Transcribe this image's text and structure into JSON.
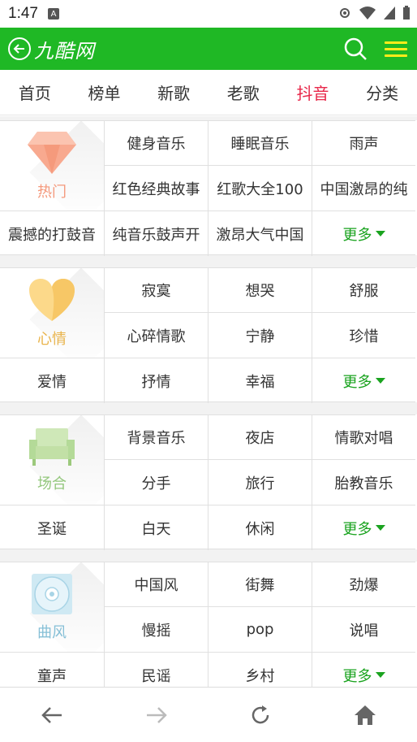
{
  "status_bar": {
    "time": "1:47",
    "notif_icon": "A"
  },
  "app_bar": {
    "title": "九酷网",
    "back_icon": "back-circle-icon",
    "search_icon": "search-icon",
    "menu_icon": "menu-icon"
  },
  "tabs": [
    {
      "label": "首页"
    },
    {
      "label": "榜单"
    },
    {
      "label": "新歌"
    },
    {
      "label": "老歌"
    },
    {
      "label": "抖音",
      "active": true
    },
    {
      "label": "分类"
    }
  ],
  "colors": {
    "brand": "#1fb825",
    "active_tab": "#e8284a",
    "more": "#1aa31f",
    "menu_lines": "#ffeb1a"
  },
  "sections": [
    {
      "category": "热门",
      "category_color": "#f4987b",
      "icon": "diamond-icon",
      "items": [
        "健身音乐",
        "睡眠音乐",
        "雨声",
        "红色经典故事",
        "红歌大全100",
        "中国激昂的纯",
        "震撼的打鼓音",
        "纯音乐鼓声开",
        "激昂大气中国"
      ],
      "more": "更多"
    },
    {
      "category": "心情",
      "category_color": "#e9b44c",
      "icon": "heart-icon",
      "items": [
        "寂寞",
        "想哭",
        "舒服",
        "心碎情歌",
        "宁静",
        "珍惜",
        "爱情",
        "抒情",
        "幸福"
      ],
      "more": "更多"
    },
    {
      "category": "场合",
      "category_color": "#93c77c",
      "icon": "sofa-icon",
      "items": [
        "背景音乐",
        "夜店",
        "情歌对唱",
        "分手",
        "旅行",
        "胎教音乐",
        "圣诞",
        "白天",
        "休闲"
      ],
      "more": "更多"
    },
    {
      "category": "曲风",
      "category_color": "#85bfd6",
      "icon": "disc-icon",
      "items": [
        "中国风",
        "街舞",
        "劲爆",
        "慢摇",
        "pop",
        "说唱",
        "童声",
        "民谣",
        "乡村"
      ],
      "more": "更多"
    }
  ],
  "bottom_nav": {
    "back": "arrow-left-icon",
    "forward": "arrow-right-icon",
    "refresh": "refresh-icon",
    "home": "home-icon"
  }
}
